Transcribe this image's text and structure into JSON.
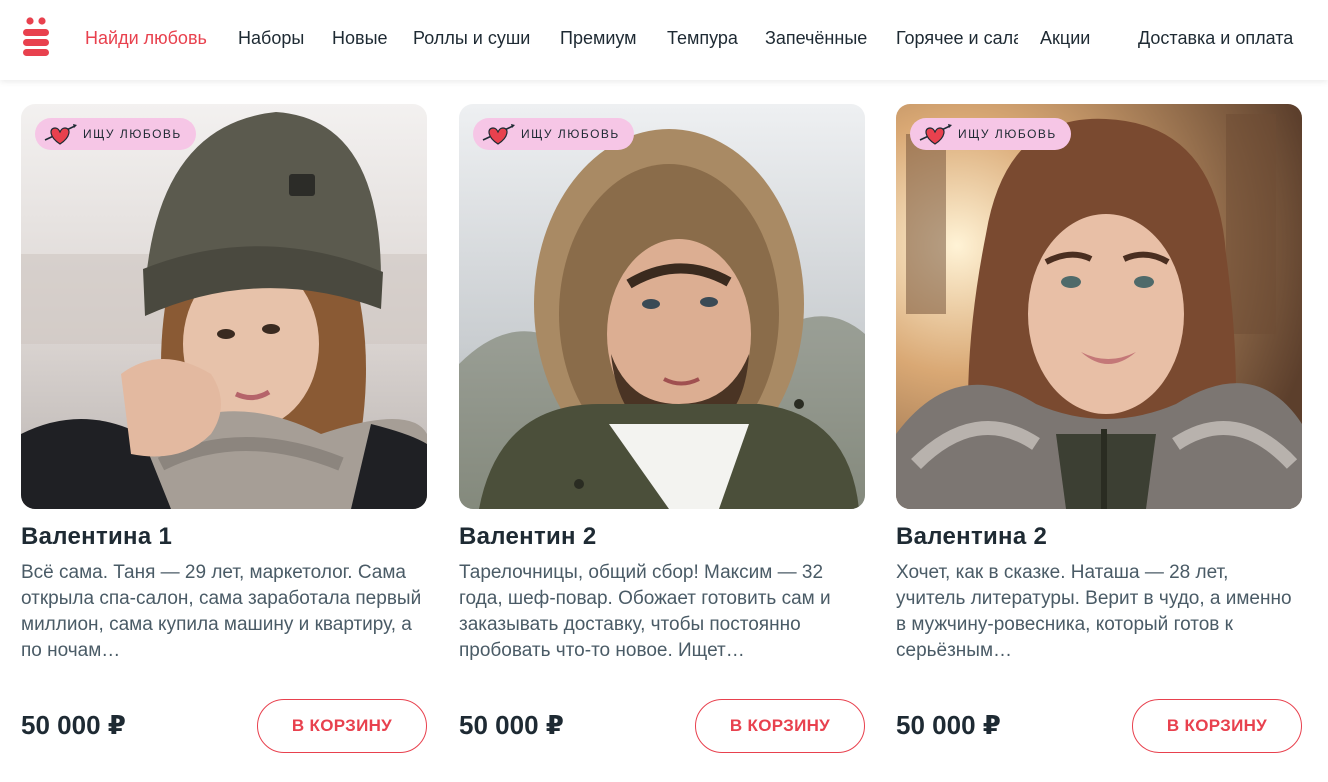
{
  "header": {
    "logo_icon": "yo-letter-logo",
    "nav": [
      {
        "label": "Найди любовь",
        "active": true
      },
      {
        "label": "Наборы"
      },
      {
        "label": "Новые"
      },
      {
        "label": "Роллы и суши"
      },
      {
        "label": "Премиум"
      },
      {
        "label": "Темпура"
      },
      {
        "label": "Запечённые"
      },
      {
        "label": "Горячее и салаты"
      },
      {
        "label": "Акции"
      },
      {
        "label": "Доставка и оплата"
      }
    ]
  },
  "colors": {
    "accent": "#e8414e",
    "badge_bg": "#f6c6e6",
    "text": "#1e2a33",
    "muted": "#4a5b66"
  },
  "cards": [
    {
      "badge": "ИЩУ ЛЮБОВЬ",
      "title": "Валентина 1",
      "description": "Всё сама. Таня — 29 лет, маркетолог. Сама открыла спа-салон, сама заработала первый миллион, сама купила машину и квартиру, а по ночам…",
      "price": "50 000 ₽",
      "button": "В КОРЗИНУ"
    },
    {
      "badge": "ИЩУ ЛЮБОВЬ",
      "title": "Валентин 2",
      "description": "Тарелочницы, общий сбор! Максим — 32 года, шеф-повар. Обожает готовить сам и заказывать доставку, чтобы постоянно пробовать что-то новое. Ищет…",
      "price": "50 000 ₽",
      "button": "В КОРЗИНУ"
    },
    {
      "badge": "ИЩУ ЛЮБОВЬ",
      "title": "Валентина 2",
      "description": "Хочет, как в сказке. Наташа — 28 лет, учитель литературы. Верит в чудо, а именно в мужчину-ровесника, который готов к серьёзным…",
      "price": "50 000 ₽",
      "button": "В КОРЗИНУ"
    }
  ]
}
